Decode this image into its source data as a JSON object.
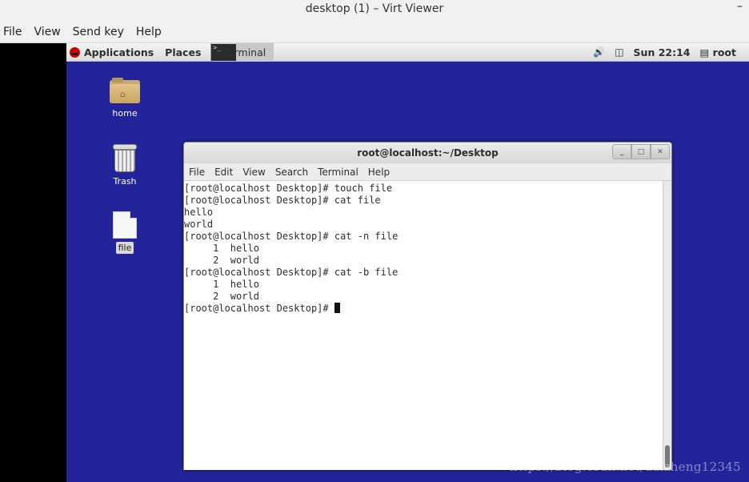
{
  "viewer": {
    "title": "desktop (1) – Virt Viewer",
    "minimize_glyph": "–",
    "menu": [
      "File",
      "View",
      "Send key",
      "Help"
    ]
  },
  "panel": {
    "applications": "Applications",
    "places": "Places",
    "task_label": "Terminal",
    "task_icon_text": ">_",
    "volume_icon": "volume-icon",
    "network_icon": "network-icon",
    "clock": "Sun 22:14",
    "user": "root"
  },
  "desktop_icons": {
    "home": "home",
    "trash": "Trash",
    "file": "file"
  },
  "terminal": {
    "title": "root@localhost:~/Desktop",
    "menu": [
      "File",
      "Edit",
      "View",
      "Search",
      "Terminal",
      "Help"
    ],
    "lines": [
      "[root@localhost Desktop]# touch file",
      "[root@localhost Desktop]# cat file",
      "hello",
      "world",
      "[root@localhost Desktop]# cat -n file",
      "     1\thello",
      "     2\tworld",
      "[root@localhost Desktop]# cat -b file",
      "     1\thello",
      "     2\tworld",
      "[root@localhost Desktop]# "
    ]
  },
  "watermark": "https://blog.csdn.net/daizheng12345"
}
